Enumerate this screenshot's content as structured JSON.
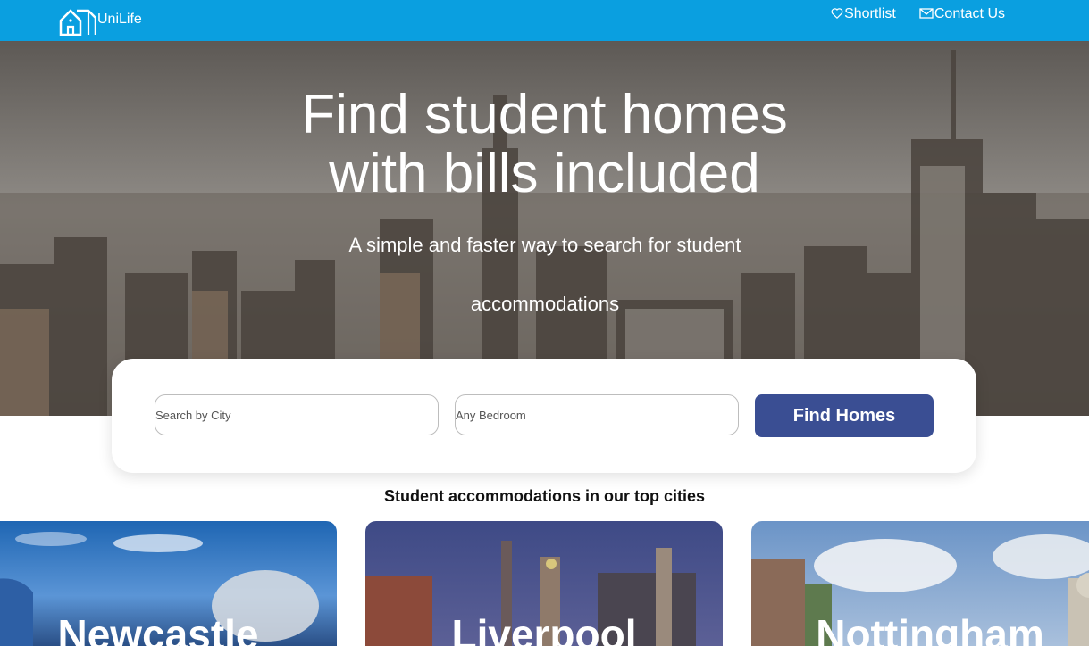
{
  "header": {
    "brand": "UniLife",
    "nav": [
      {
        "label": "Shortlist",
        "icon": "heart-icon"
      },
      {
        "label": "Contact Us",
        "icon": "mail-icon"
      }
    ]
  },
  "hero": {
    "title_line1": "Find student homes",
    "title_line2": "with bills included",
    "subtitle": "A simple and faster way to search for student accommodations"
  },
  "search": {
    "city_placeholder": "Search by City",
    "bedroom_placeholder": "Any Bedroom",
    "button_label": "Find Homes"
  },
  "cities": {
    "heading": "Student accommodations in our top cities",
    "items": [
      {
        "name": "Newcastle"
      },
      {
        "name": "Liverpool"
      },
      {
        "name": "Nottingham"
      }
    ]
  },
  "colors": {
    "header_bg": "#0a9fe0",
    "button_bg": "#3a4e93"
  }
}
